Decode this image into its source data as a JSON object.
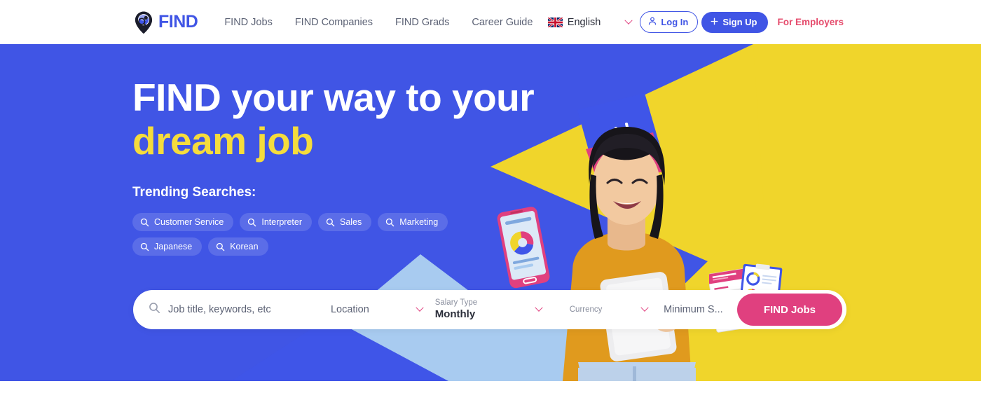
{
  "brand": {
    "name": "FIND",
    "logo_icon": "location-pin-search-icon",
    "colors": {
      "blue": "#4055E5",
      "yellow": "#F0D52B",
      "headline_yellow": "#F5DC3C",
      "pink": "#E0407F",
      "employer_red": "#E54B6C",
      "white": "#FFFFFF",
      "light_blue": "#A8CBF0"
    }
  },
  "header": {
    "nav": [
      {
        "label": "FIND Jobs",
        "name": "nav-find-jobs"
      },
      {
        "label": "FIND Companies",
        "name": "nav-find-companies"
      },
      {
        "label": "FIND Grads",
        "name": "nav-find-grads"
      },
      {
        "label": "Career Guide",
        "name": "nav-career-guide"
      }
    ],
    "language": {
      "label": "English",
      "flag_icon": "uk-flag-icon",
      "chevron_icon": "chevron-down-icon"
    },
    "login": {
      "label": "Log In",
      "icon": "user-icon"
    },
    "signup": {
      "label": "Sign Up",
      "icon": "plus-icon"
    },
    "for_employers": {
      "label": "For Employers"
    }
  },
  "hero": {
    "headline_line1": "FIND your way to your",
    "headline_line2": "dream job",
    "trending_title": "Trending Searches:",
    "trending": [
      {
        "label": "Customer Service",
        "icon": "search-icon"
      },
      {
        "label": "Interpreter",
        "icon": "search-icon"
      },
      {
        "label": "Sales",
        "icon": "search-icon"
      },
      {
        "label": "Marketing",
        "icon": "search-icon"
      },
      {
        "label": "Japanese",
        "icon": "search-icon"
      },
      {
        "label": "Korean",
        "icon": "search-icon"
      }
    ]
  },
  "search": {
    "keywords": {
      "placeholder": "Job title, keywords, etc",
      "value": "",
      "icon": "search-icon"
    },
    "location": {
      "placeholder": "Location",
      "value": "",
      "chevron_icon": "chevron-down-icon"
    },
    "salary_type": {
      "label": "Salary Type",
      "value": "Monthly",
      "chevron_icon": "chevron-down-icon"
    },
    "currency": {
      "label": "Currency",
      "value": "",
      "chevron_icon": "chevron-down-icon"
    },
    "minimum_salary": {
      "placeholder": "Minimum S...",
      "value": ""
    },
    "submit": {
      "label": "FIND Jobs"
    }
  }
}
